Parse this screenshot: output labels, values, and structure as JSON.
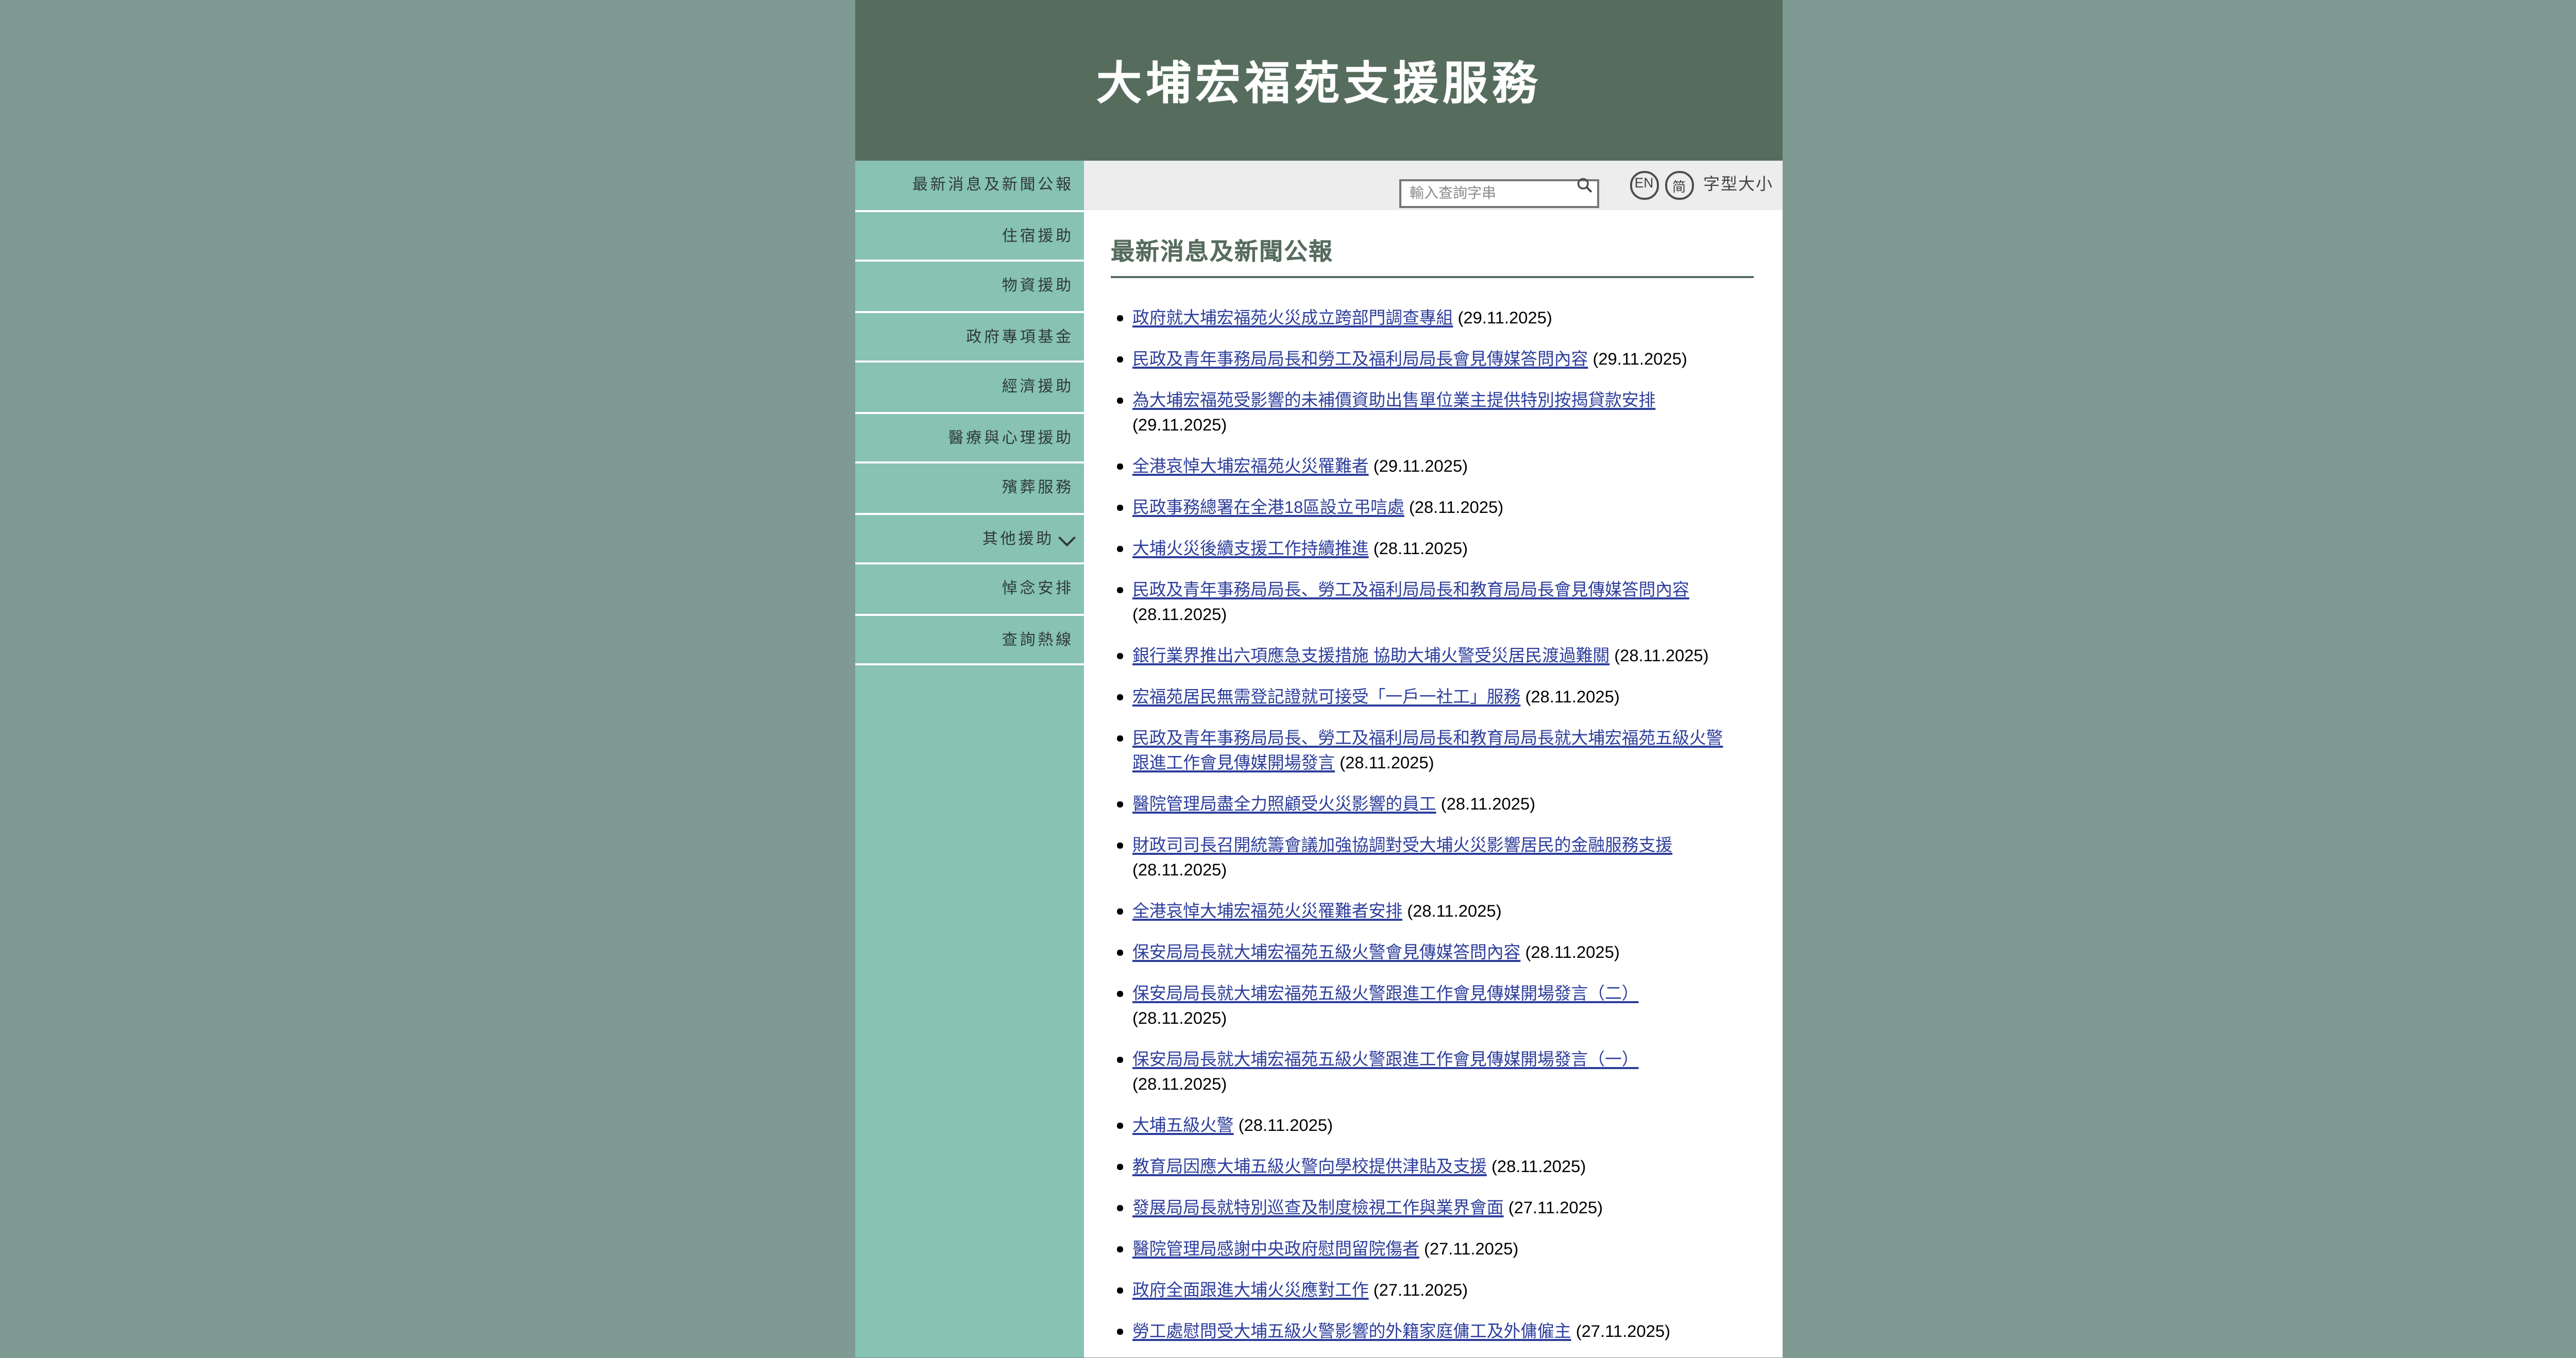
{
  "header": {
    "title": "大埔宏福苑支援服務"
  },
  "sidebar": {
    "items": [
      {
        "label": "最新消息及新聞公報",
        "expandable": false
      },
      {
        "label": "住宿援助",
        "expandable": false
      },
      {
        "label": "物資援助",
        "expandable": false
      },
      {
        "label": "政府專項基金",
        "expandable": false
      },
      {
        "label": "經濟援助",
        "expandable": false
      },
      {
        "label": "醫療與心理援助",
        "expandable": false
      },
      {
        "label": "殯葬服務",
        "expandable": false
      },
      {
        "label": "其他援助",
        "expandable": true
      },
      {
        "label": "悼念安排",
        "expandable": false
      },
      {
        "label": "查詢熱線",
        "expandable": false
      }
    ]
  },
  "toolbar": {
    "search_placeholder": "輸入查詢字串",
    "search_value": "",
    "lang_en": "EN",
    "lang_simplified": "简",
    "font_size_label": "字型大小"
  },
  "content": {
    "heading": "最新消息及新聞公報",
    "news": [
      {
        "title": "政府就大埔宏福苑火災成立跨部門調查專組",
        "date": "(29.11.2025)"
      },
      {
        "title": "民政及青年事務局局長和勞工及福利局局長會見傳媒答問內容",
        "date": "(29.11.2025)"
      },
      {
        "title": "為大埔宏福苑受影響的未補價資助出售單位業主提供特別按揭貸款安排",
        "date": "(29.11.2025)"
      },
      {
        "title": "全港哀悼大埔宏福苑火災罹難者",
        "date": "(29.11.2025)"
      },
      {
        "title": "民政事務總署在全港18區設立弔唁處",
        "date": "(28.11.2025)"
      },
      {
        "title": "大埔火災後續支援工作持續推進",
        "date": "(28.11.2025)"
      },
      {
        "title": "民政及青年事務局局長、勞工及福利局局長和教育局局長會見傳媒答問內容",
        "date": "(28.11.2025)"
      },
      {
        "title": "銀行業界推出六項應急支援措施 協助大埔火警受災居民渡過難關",
        "date": "(28.11.2025)"
      },
      {
        "title": "宏福苑居民無需登記證就可接受「一戶一社工」服務",
        "date": "(28.11.2025)"
      },
      {
        "title": "民政及青年事務局局長、勞工及福利局局長和教育局局長就大埔宏福苑五級火警跟進工作會見傳媒開場發言",
        "date": "(28.11.2025)"
      },
      {
        "title": "醫院管理局盡全力照顧受火災影響的員工",
        "date": "(28.11.2025)"
      },
      {
        "title": "財政司司長召開統籌會議加強協調對受大埔火災影響居民的金融服務支援",
        "date": "(28.11.2025)"
      },
      {
        "title": "全港哀悼大埔宏福苑火災罹難者安排",
        "date": "(28.11.2025)"
      },
      {
        "title": "保安局局長就大埔宏福苑五級火警會見傳媒答問內容",
        "date": "(28.11.2025)"
      },
      {
        "title": "保安局局長就大埔宏福苑五級火警跟進工作會見傳媒開場發言（二）",
        "date": "(28.11.2025)"
      },
      {
        "title": "保安局局長就大埔宏福苑五級火警跟進工作會見傳媒開場發言（一）",
        "date": "(28.11.2025)"
      },
      {
        "title": "大埔五級火警",
        "date": "(28.11.2025)"
      },
      {
        "title": "教育局因應大埔五級火警向學校提供津貼及支援",
        "date": "(28.11.2025)"
      },
      {
        "title": "發展局局長就特別巡查及制度檢視工作與業界會面",
        "date": "(27.11.2025)"
      },
      {
        "title": "醫院管理局感謝中央政府慰問留院傷者",
        "date": "(27.11.2025)"
      },
      {
        "title": "政府全面跟進大埔火災應對工作",
        "date": "(27.11.2025)"
      },
      {
        "title": "勞工處慰問受大埔五級火警影響的外籍家庭傭工及外傭僱主",
        "date": "(27.11.2025)"
      }
    ]
  },
  "colors": {
    "outer-bg": "#7e9a93",
    "header-green": "#566d5e",
    "sidebar-teal": "#87c2b3",
    "heading-green": "#566c5e",
    "link-blue": "#2d3e9c"
  }
}
